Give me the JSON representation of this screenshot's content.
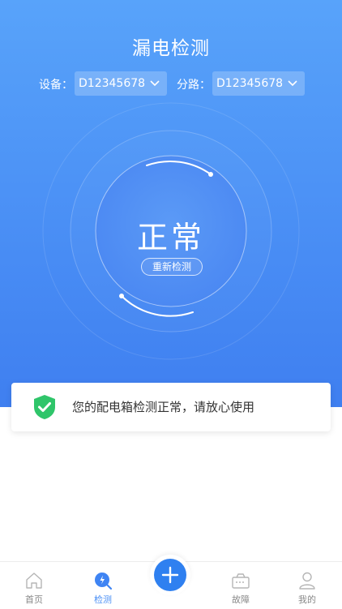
{
  "header": {
    "title": "漏电检测"
  },
  "device": {
    "label": "设备：",
    "value": "D12345678"
  },
  "branch": {
    "label": "分路：",
    "value": "D12345678"
  },
  "gauge": {
    "status": "正常",
    "recheck_label": "重新检测"
  },
  "notice": {
    "icon": "shield-check-icon",
    "message": "您的配电箱检测正常，请放心使用",
    "icon_color": "#2fc56a"
  },
  "tabbar": {
    "items": [
      {
        "label": "首页",
        "icon": "home-icon",
        "active": false
      },
      {
        "label": "检测",
        "icon": "detect-icon",
        "active": true
      },
      {
        "label": "故障",
        "icon": "fault-icon",
        "active": false
      },
      {
        "label": "我的",
        "icon": "user-icon",
        "active": false
      }
    ],
    "fab_icon": "plus-icon"
  },
  "colors": {
    "accent": "#4a8ff5",
    "fab": "#2f80f0",
    "ok": "#2fc56a"
  }
}
